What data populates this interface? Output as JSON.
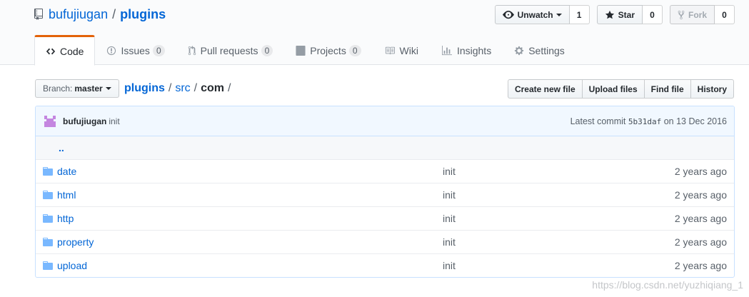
{
  "repo": {
    "owner": "bufujiugan",
    "separator": "/",
    "name": "plugins"
  },
  "actions": {
    "watch": {
      "label": "Unwatch",
      "count": "1"
    },
    "star": {
      "label": "Star",
      "count": "0"
    },
    "fork": {
      "label": "Fork",
      "count": "0"
    }
  },
  "nav": {
    "code": "Code",
    "issues": {
      "label": "Issues",
      "count": "0"
    },
    "pulls": {
      "label": "Pull requests",
      "count": "0"
    },
    "projects": {
      "label": "Projects",
      "count": "0"
    },
    "wiki": "Wiki",
    "insights": "Insights",
    "settings": "Settings"
  },
  "branch": {
    "label": "Branch:",
    "name": "master"
  },
  "breadcrumb": {
    "root": "plugins",
    "sep": "/",
    "parts": [
      "src"
    ],
    "current": "com"
  },
  "file_actions": {
    "create": "Create new file",
    "upload": "Upload files",
    "find": "Find file",
    "history": "History"
  },
  "commit": {
    "author": "bufujiugan",
    "message": "init",
    "latest_label": "Latest commit",
    "sha": "5b31daf",
    "on": "on",
    "date": "13 Dec 2016"
  },
  "up_dir": "..",
  "files": [
    {
      "name": "date",
      "message": "init",
      "age": "2 years ago"
    },
    {
      "name": "html",
      "message": "init",
      "age": "2 years ago"
    },
    {
      "name": "http",
      "message": "init",
      "age": "2 years ago"
    },
    {
      "name": "property",
      "message": "init",
      "age": "2 years ago"
    },
    {
      "name": "upload",
      "message": "init",
      "age": "2 years ago"
    }
  ],
  "watermark": "https://blog.csdn.net/yuzhiqiang_1",
  "colors": {
    "link": "#0366d6",
    "tab_accent": "#e36209",
    "commit_bg": "#f1f8ff",
    "folder": "#79b8ff"
  }
}
